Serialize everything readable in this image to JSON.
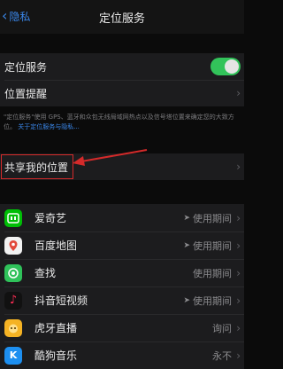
{
  "nav": {
    "back_label": "隐私",
    "title": "定位服务"
  },
  "settings": {
    "location_services_label": "定位服务",
    "location_services_on": true,
    "location_alerts_label": "位置提醒"
  },
  "footnote": {
    "text": "\"定位服务\"使用 GPS、蓝牙和众包无线局域网热点以及信号塔位置来确定您的大致方位。",
    "link": "关于定位服务与隐私..."
  },
  "share": {
    "label": "共享我的位置"
  },
  "apps": [
    {
      "name": "爱奇艺",
      "status": "使用期间",
      "arrow": true,
      "icon": "iqiyi-icon",
      "color": "#00be06"
    },
    {
      "name": "百度地图",
      "status": "使用期间",
      "arrow": true,
      "icon": "baidu-map-icon",
      "color": "#f2f2f2"
    },
    {
      "name": "查找",
      "status": "使用期间",
      "arrow": false,
      "icon": "find-my-icon",
      "color": "#2fc25a"
    },
    {
      "name": "抖音短视频",
      "status": "使用期间",
      "arrow": true,
      "icon": "douyin-icon",
      "color": "#111111"
    },
    {
      "name": "虎牙直播",
      "status": "询问",
      "arrow": false,
      "icon": "huya-icon",
      "color": "#f5b324"
    },
    {
      "name": "酷狗音乐",
      "status": "永不",
      "arrow": false,
      "icon": "kugou-icon",
      "color": "#1d8ff0"
    }
  ],
  "colors": {
    "accent": "#3a86e8",
    "toggle_on": "#32c35a",
    "highlight": "#d42a2a"
  }
}
